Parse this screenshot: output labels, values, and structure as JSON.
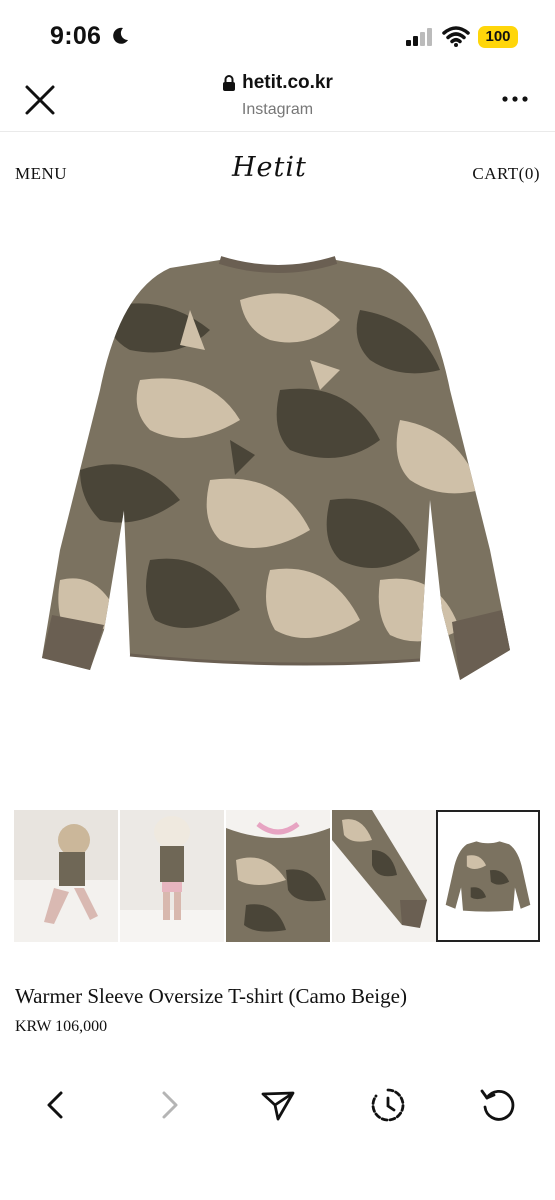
{
  "status_bar": {
    "time": "9:06",
    "battery": "100",
    "icons": [
      "moon-icon",
      "signal-icon",
      "wifi-icon",
      "battery-icon"
    ]
  },
  "browser": {
    "domain": "hetit.co.kr",
    "source": "Instagram",
    "icons": [
      "close-icon",
      "lock-icon",
      "more-icon"
    ]
  },
  "site_nav": {
    "menu": "MENU",
    "brand": "Hetit",
    "cart": "CART(0)"
  },
  "product": {
    "title": "Warmer Sleeve Oversize T-shirt (Camo Beige)",
    "price": "KRW 106,000",
    "thumbnails": [
      {
        "name": "thumb-model-seated"
      },
      {
        "name": "thumb-model-standing"
      },
      {
        "name": "thumb-collar-detail"
      },
      {
        "name": "thumb-sleeve-detail"
      },
      {
        "name": "thumb-full-shirt",
        "selected": true
      }
    ]
  },
  "toolbar": {
    "icons": [
      "back-icon",
      "forward-icon",
      "share-icon",
      "history-icon",
      "reload-icon"
    ]
  },
  "colors": {
    "camo_dark": "#4a4538",
    "camo_mid": "#7b7260",
    "camo_light": "#cfc0a8",
    "cuff": "#6a5f52",
    "battery": "#ffd60a"
  }
}
